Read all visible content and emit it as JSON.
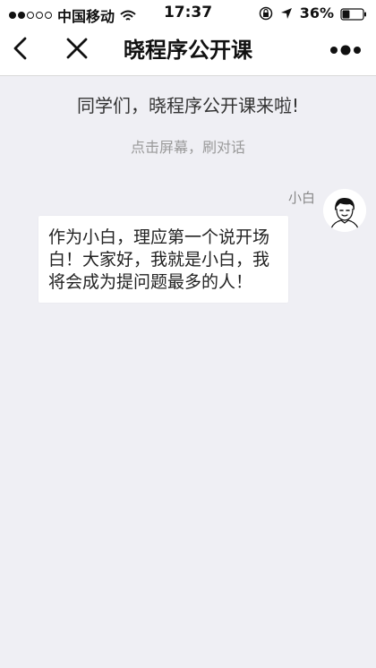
{
  "status_bar": {
    "carrier": "中国移动",
    "time": "17:37",
    "battery_percent": "36%",
    "signal_level": 2,
    "signal_total": 5,
    "battery_level": 0.36,
    "icons": [
      "signal-icon",
      "wifi-icon",
      "rotation-lock-icon",
      "location-arrow-icon",
      "battery-icon"
    ]
  },
  "nav": {
    "title": "晓程序公开课",
    "icons": [
      "back-icon",
      "close-icon",
      "more-icon"
    ]
  },
  "chat": {
    "announcement": "同学们，晓程序公开课来啦!",
    "hint": "点击屏幕，刷对话",
    "message": {
      "sender": "小白",
      "text": "作为小白，理应第一个说开场白！大家好，我就是小白，我将会成为提问题最多的人！",
      "avatar_icon": "user-avatar-icon"
    }
  },
  "colors": {
    "background": "#efeff4",
    "bubble": "#ffffff",
    "hint_text": "#9a9a9a",
    "nav_background": "#ffffff"
  }
}
